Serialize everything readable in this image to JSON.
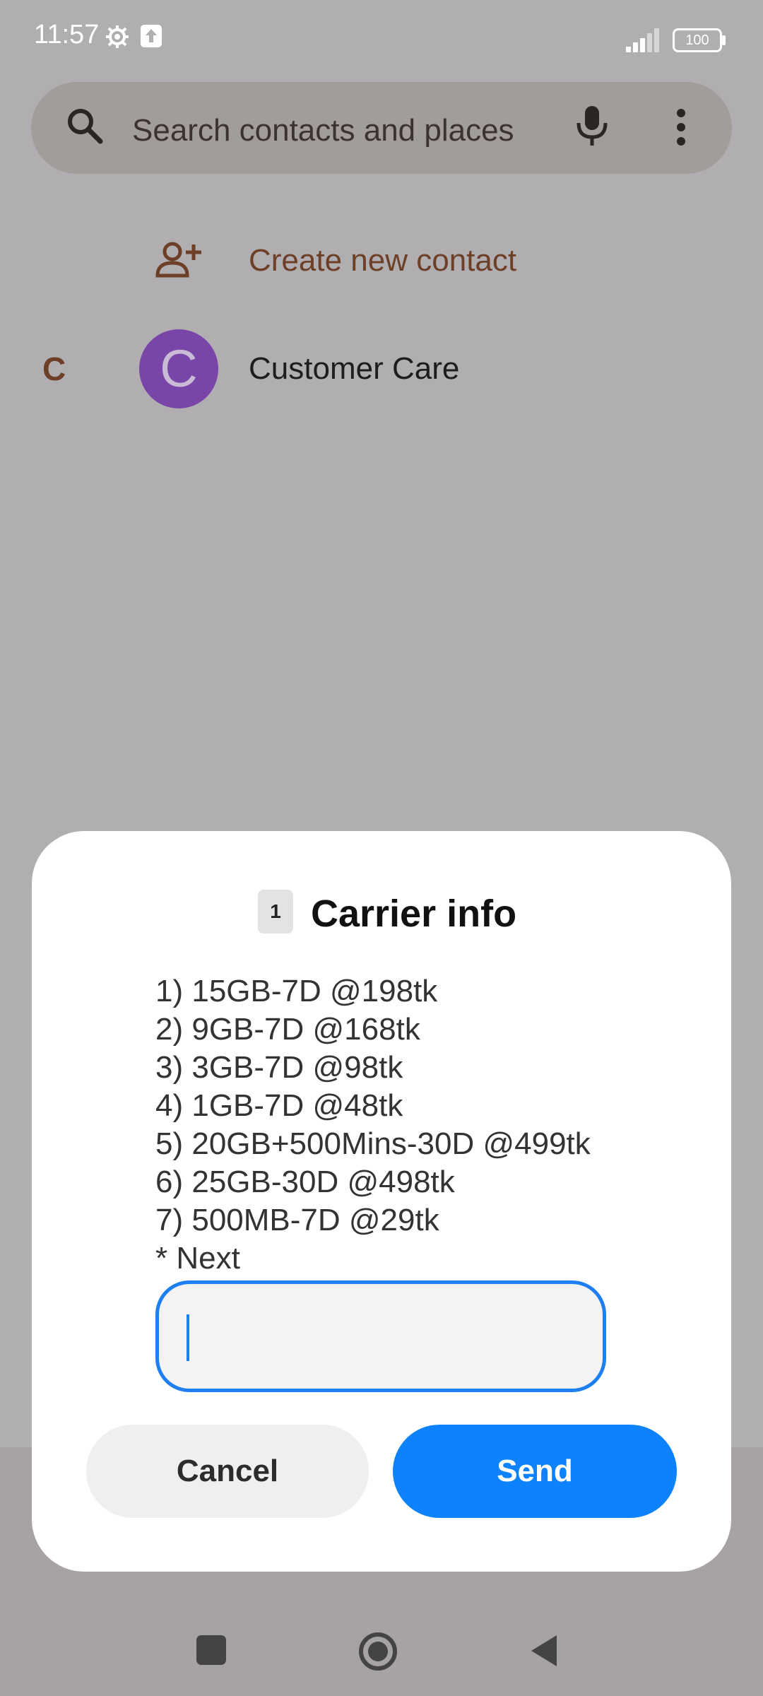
{
  "status_bar": {
    "time": "11:57",
    "battery": "100"
  },
  "search": {
    "placeholder": "Search contacts and places"
  },
  "contacts": {
    "create_label": "Create new contact",
    "section_letter": "C",
    "items": [
      {
        "avatar_letter": "C",
        "name": "Customer Care"
      }
    ]
  },
  "dialog": {
    "sim_slot": "1",
    "title": "Carrier info",
    "menu_lines": [
      "1) 15GB-7D @198tk",
      "2) 9GB-7D @168tk",
      "3) 3GB-7D @98tk",
      "4) 1GB-7D @48tk",
      "5) 20GB+500Mins-30D @499tk",
      "6) 25GB-30D @498tk",
      "7) 500MB-7D @29tk",
      "* Next"
    ],
    "input_value": "",
    "cancel_label": "Cancel",
    "send_label": "Send"
  },
  "colors": {
    "accent": "#0d82fc",
    "avatar": "#7a45a8",
    "brand_text": "#6d3f26"
  }
}
